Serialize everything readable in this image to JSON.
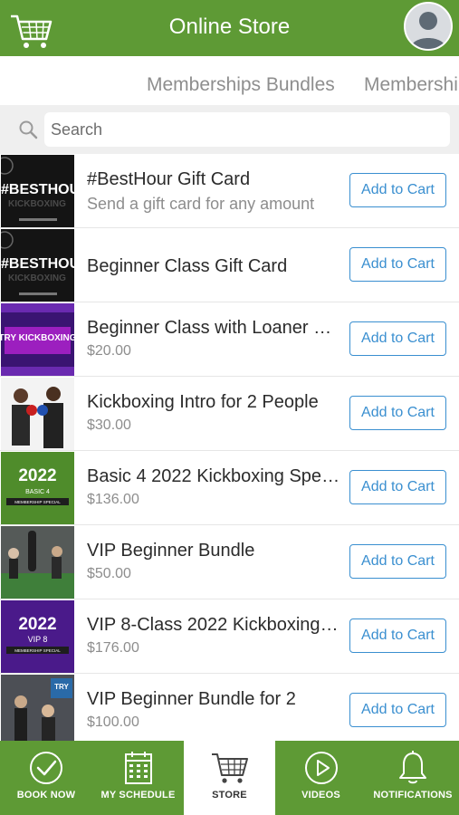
{
  "header": {
    "title": "Online Store",
    "cart_icon": "shopping-cart-icon",
    "avatar_icon": "user-avatar-icon"
  },
  "tabs": [
    {
      "label": "Memberships Bundles"
    },
    {
      "label": "Memberships"
    }
  ],
  "search": {
    "placeholder": "Search",
    "value": ""
  },
  "products": [
    {
      "name": "#BestHour Gift Card",
      "subtitle": "Send a gift card for any amount",
      "button": "Add to Cart",
      "thumb_text": "#BESTHOUR"
    },
    {
      "name": "Beginner Class Gift Card",
      "subtitle": "",
      "button": "Add to Cart",
      "thumb_text": "#BESTHOUR"
    },
    {
      "name": "Beginner Class with Loaner …",
      "subtitle": "$20.00",
      "button": "Add to Cart",
      "thumb_text": "TRY KICKBOXING"
    },
    {
      "name": "Kickboxing Intro for 2 People",
      "subtitle": "$30.00",
      "button": "Add to Cart",
      "thumb_text": ""
    },
    {
      "name": "Basic 4 2022 Kickboxing Spec…",
      "subtitle": "$136.00",
      "button": "Add to Cart",
      "thumb_text": "2022"
    },
    {
      "name": "VIP Beginner Bundle",
      "subtitle": "$50.00",
      "button": "Add to Cart",
      "thumb_text": ""
    },
    {
      "name": "VIP 8-Class 2022 Kickboxing …",
      "subtitle": "$176.00",
      "button": "Add to Cart",
      "thumb_text": "2022"
    },
    {
      "name": "VIP Beginner Bundle for 2",
      "subtitle": "$100.00",
      "button": "Add to Cart",
      "thumb_text": "TRY"
    }
  ],
  "thumb_small": {
    "kickboxing": "KICKBOXING",
    "basic4": "BASIC 4",
    "vip8": "VIP 8",
    "membership_special": "MEMBERSHIP SPECIAL"
  },
  "tabbar": [
    {
      "label": "BOOK NOW",
      "icon": "check-circle-icon"
    },
    {
      "label": "MY SCHEDULE",
      "icon": "calendar-icon"
    },
    {
      "label": "STORE",
      "icon": "shopping-cart-icon",
      "active": true
    },
    {
      "label": "VIDEOS",
      "icon": "play-circle-icon"
    },
    {
      "label": "NOTIFICATIONS",
      "icon": "bell-icon"
    }
  ],
  "colors": {
    "brand_green": "#5e9a35",
    "accent_blue": "#3a8fd0",
    "search_bg": "#efefef"
  }
}
